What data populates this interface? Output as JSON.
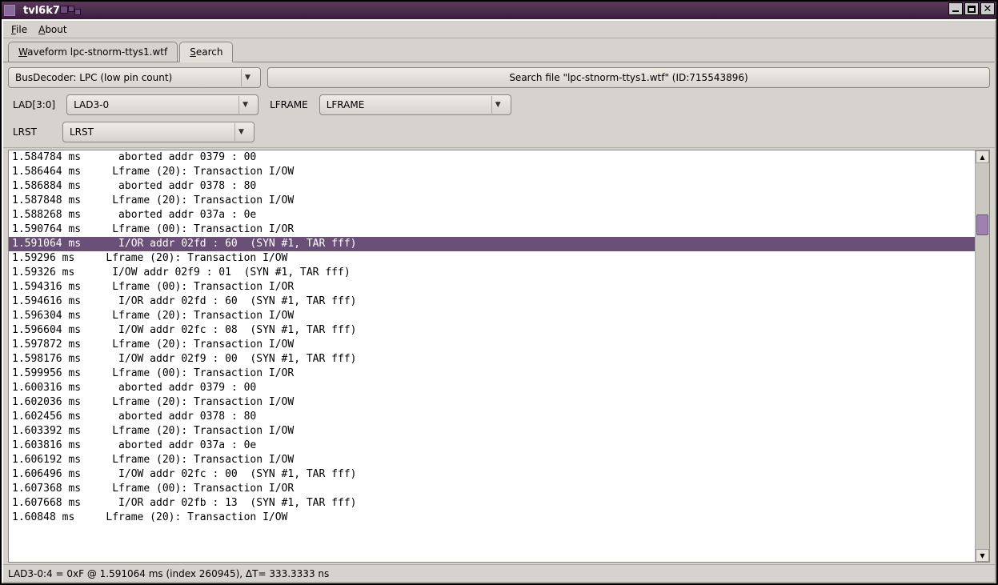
{
  "window": {
    "title": "tvl6k7"
  },
  "menu": {
    "file": "File",
    "about": "About"
  },
  "tabs": {
    "waveform": "Waveform lpc-stnorm-ttys1.wtf",
    "search": "Search"
  },
  "toolbar": {
    "decoder": "BusDecoder: LPC (low pin count)",
    "search_button": "Search file \"lpc-stnorm-ttys1.wtf\" (ID:715543896)"
  },
  "signals": {
    "lad_label": "LAD[3:0]",
    "lad_value": "LAD3-0",
    "lframe_label": "LFRAME",
    "lframe_value": "LFRAME",
    "lrst_label": "LRST",
    "lrst_value": "LRST"
  },
  "rows": [
    {
      "sel": false,
      "text": "1.584784 ms      aborted addr 0379 : 00"
    },
    {
      "sel": false,
      "text": "1.586464 ms     Lframe (20): Transaction I/OW"
    },
    {
      "sel": false,
      "text": "1.586884 ms      aborted addr 0378 : 80"
    },
    {
      "sel": false,
      "text": "1.587848 ms     Lframe (20): Transaction I/OW"
    },
    {
      "sel": false,
      "text": "1.588268 ms      aborted addr 037a : 0e"
    },
    {
      "sel": false,
      "text": "1.590764 ms     Lframe (00): Transaction I/OR"
    },
    {
      "sel": true,
      "text": "1.591064 ms      I/OR addr 02fd : 60  (SYN #1, TAR fff)"
    },
    {
      "sel": false,
      "text": "1.59296 ms     Lframe (20): Transaction I/OW"
    },
    {
      "sel": false,
      "text": "1.59326 ms      I/OW addr 02f9 : 01  (SYN #1, TAR fff)"
    },
    {
      "sel": false,
      "text": "1.594316 ms     Lframe (00): Transaction I/OR"
    },
    {
      "sel": false,
      "text": "1.594616 ms      I/OR addr 02fd : 60  (SYN #1, TAR fff)"
    },
    {
      "sel": false,
      "text": "1.596304 ms     Lframe (20): Transaction I/OW"
    },
    {
      "sel": false,
      "text": "1.596604 ms      I/OW addr 02fc : 08  (SYN #1, TAR fff)"
    },
    {
      "sel": false,
      "text": "1.597872 ms     Lframe (20): Transaction I/OW"
    },
    {
      "sel": false,
      "text": "1.598176 ms      I/OW addr 02f9 : 00  (SYN #1, TAR fff)"
    },
    {
      "sel": false,
      "text": "1.599956 ms     Lframe (00): Transaction I/OR"
    },
    {
      "sel": false,
      "text": "1.600316 ms      aborted addr 0379 : 00"
    },
    {
      "sel": false,
      "text": "1.602036 ms     Lframe (20): Transaction I/OW"
    },
    {
      "sel": false,
      "text": "1.602456 ms      aborted addr 0378 : 80"
    },
    {
      "sel": false,
      "text": "1.603392 ms     Lframe (20): Transaction I/OW"
    },
    {
      "sel": false,
      "text": "1.603816 ms      aborted addr 037a : 0e"
    },
    {
      "sel": false,
      "text": "1.606192 ms     Lframe (20): Transaction I/OW"
    },
    {
      "sel": false,
      "text": "1.606496 ms      I/OW addr 02fc : 00  (SYN #1, TAR fff)"
    },
    {
      "sel": false,
      "text": "1.607368 ms     Lframe (00): Transaction I/OR"
    },
    {
      "sel": false,
      "text": "1.607668 ms      I/OR addr 02fb : 13  (SYN #1, TAR fff)"
    },
    {
      "sel": false,
      "text": "1.60848 ms     Lframe (20): Transaction I/OW"
    }
  ],
  "statusbar": "LAD3-0:4 = 0xF @ 1.591064 ms  (index 260945), ΔT= 333.3333 ns"
}
